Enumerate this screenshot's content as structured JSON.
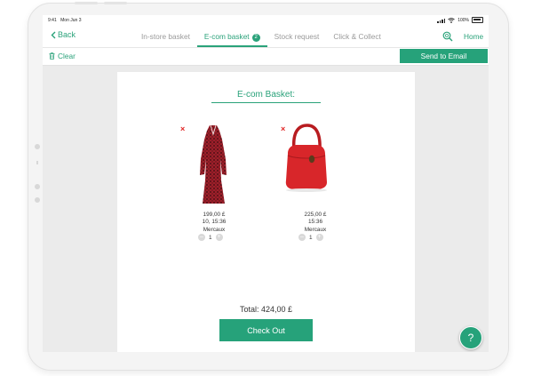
{
  "status_bar": {
    "time": "9:41",
    "date": "Mon Jun 3",
    "battery": "100%"
  },
  "nav": {
    "back_label": "Back",
    "tabs": [
      {
        "label": "In-store basket",
        "active": false
      },
      {
        "label": "E-com basket",
        "active": true,
        "badge": "2"
      },
      {
        "label": "Stock request",
        "active": false
      },
      {
        "label": "Click & Collect",
        "active": false
      }
    ],
    "home_label": "Home",
    "search_icon": "search-icon"
  },
  "toolbar": {
    "clear_label": "Clear",
    "send_label": "Send to Email"
  },
  "basket": {
    "title": "E-com Basket:",
    "items": [
      {
        "name": "dress",
        "price": "199,00 £",
        "time": "10, 15:36",
        "store": "Mercaux",
        "quantity": "1",
        "remove_icon": "×"
      },
      {
        "name": "bag",
        "price": "225,00 £",
        "time": "15:36",
        "store": "Mercaux",
        "quantity": "1",
        "remove_icon": "×"
      }
    ],
    "total": "Total: 424,00 £",
    "checkout_label": "Check Out"
  },
  "help_label": "?",
  "colors": {
    "accent": "#26a27a",
    "remove": "#e02424"
  }
}
